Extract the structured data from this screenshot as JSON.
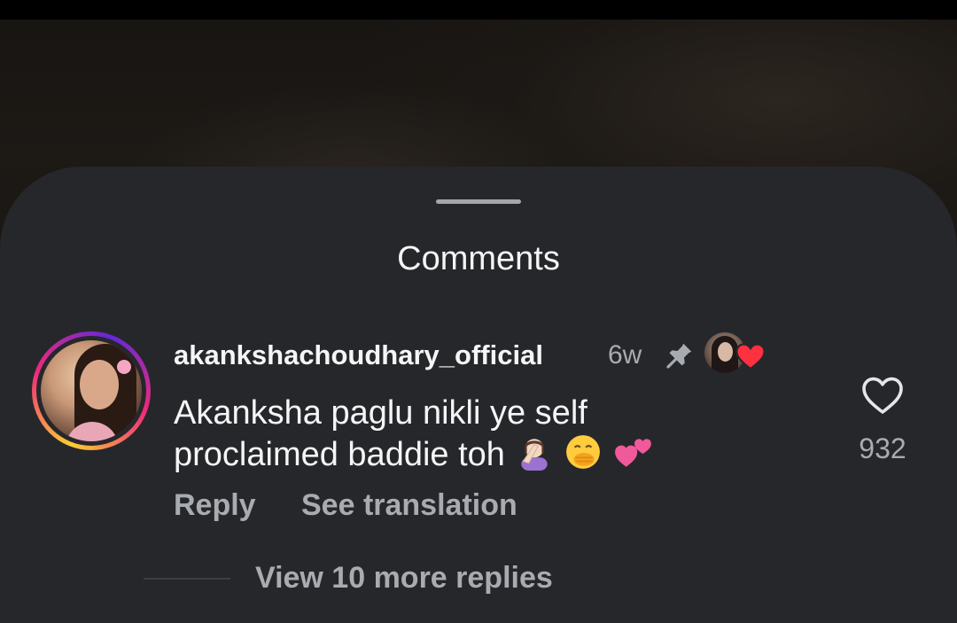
{
  "sheet": {
    "title": "Comments"
  },
  "comment": {
    "username": "akankshachoudhary_official",
    "timestamp": "6w",
    "pinned_icon": "pin-icon",
    "creator_liked_badge": "red-heart-icon",
    "text_line1": "Akanksha paglu nikli ye self",
    "text_line2": "proclaimed baddie toh",
    "emojis": [
      "woman-facepalming-emoji",
      "face-with-hand-over-mouth-emoji",
      "two-hearts-emoji"
    ],
    "reply_label": "Reply",
    "translate_label": "See translation",
    "like_icon": "heart-outline-icon",
    "like_count": "932",
    "view_replies_label": "View 10 more replies"
  },
  "colors": {
    "sheet_bg": "#26272b",
    "primary_text": "#f5f5f5",
    "secondary_text": "#a8abb0",
    "heart_red": "#ff3040"
  }
}
